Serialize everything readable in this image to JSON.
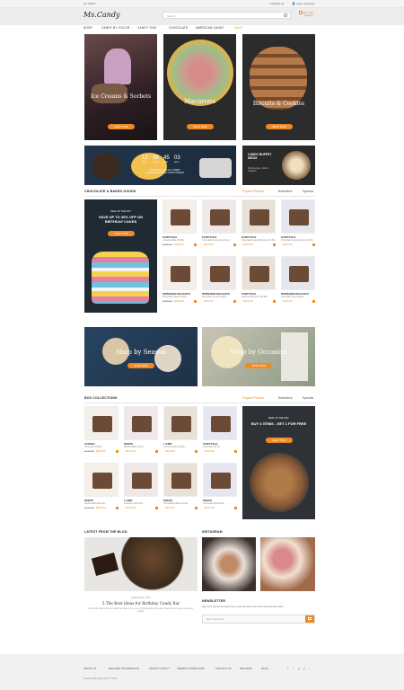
{
  "topbar": {
    "currency": "$ ▾ USD ▾",
    "account": "♡ Wishlist (0)",
    "login": "👤 Login / Register"
  },
  "header": {
    "logo": "Ms.Candy",
    "search_placeholder": "Search",
    "cart_label": "MY CART",
    "cart_items": "0 item(s)"
  },
  "nav": [
    "SHOP",
    "CANDY BY COLOR",
    "CANDY TINS",
    "CHOCOLATE",
    "AMERICAN CANDY",
    "SALE"
  ],
  "banners": {
    "b1_title": "Ice Creams & Sorbets",
    "b1_btn": "SHOP NOW",
    "b2_title": "Macarons",
    "b2_btn": "SHOP NOW",
    "b3_title": "Biscuits & Cookies",
    "b3_btn": "SHOP NOW"
  },
  "promo": {
    "timer": [
      "12",
      "38",
      "45",
      "03"
    ],
    "timer_labels": [
      "DAYS",
      "HOURS",
      "MINS",
      "SECS"
    ],
    "offer_line1": "SAVE UP TO 30% ALL YUMMY",
    "offer_line2": "CANDY. DON'T MISS YOUR CHANCE!",
    "ideas_title": "CANDY BUFFET IDEAS",
    "ideas_sub": "Shop by type, color & occasion"
  },
  "section1": {
    "title": "CHOCOLATE & BAKED GOODS",
    "tabs": [
      "Popular Products",
      "Bestsellers",
      "Specials"
    ],
    "deal_tag": "DEAL OF THE DAY",
    "deal_text": "SAVE UP TO 30% OFF ON BIRTHDAY CAKES",
    "deal_btn": "SHOP NOW",
    "products": [
      {
        "brand": "FAIRYTALE",
        "desc": "Chocolate Bar Gift Box",
        "old": "$135.00",
        "price": "$122.00"
      },
      {
        "brand": "FAIRYTALE",
        "desc": "Chocolate Candy Assortment",
        "old": "",
        "price": "$122.00"
      },
      {
        "brand": "FAIRYTALE",
        "desc": "Chocolate Fudge Brownies Gift Box",
        "old": "",
        "price": "$122.00"
      },
      {
        "brand": "FAIRYTALE",
        "desc": "Chocolate Candy Assortment Box",
        "old": "",
        "price": "$122.00"
      },
      {
        "brand": "WOMHEIN DELIGHTS",
        "desc": "Chocolate Wafer Cookies",
        "old": "$135.00",
        "price": "$122.00"
      },
      {
        "brand": "WOMHEIN DELIGHTS",
        "desc": "Chocolate Chunk Cookies",
        "old": "",
        "price": "$122.00"
      },
      {
        "brand": "FAIRYTALE",
        "desc": "Gourmet Brownies Gift Box",
        "old": "",
        "price": "$122.00"
      },
      {
        "brand": "WOMHEIN DELIGHTS",
        "desc": "Chocolate Chip Cookies",
        "old": "",
        "price": "$122.00"
      }
    ]
  },
  "occasion": {
    "left_title": "Shop by Season",
    "left_btn": "SHOP NOW",
    "right_title": "Shop by Occasion",
    "right_btn": "SHOP NOW"
  },
  "section2": {
    "title": "BOX COLLECTIONS",
    "tabs": [
      "Popular Products",
      "Bestsellers",
      "Specials"
    ],
    "deal_tag": "DEAL OF THE DAY",
    "deal_text": "BUY 4 ITEMS - GET 1 FOR FREE",
    "deal_btn": "SHOP NOW",
    "products": [
      {
        "brand": "GODIVA",
        "desc": "Chocolate Gift Box",
        "old": "$135.00",
        "price": "$122.00"
      },
      {
        "brand": "PEEPS",
        "desc": "Marshmallow Chicks",
        "old": "",
        "price": "$122.00"
      },
      {
        "brand": "L'AMIT",
        "desc": "Candy Assortment Box",
        "old": "",
        "price": "$122.00"
      },
      {
        "brand": "FAIRYTALE",
        "desc": "Chocolate Gift Tin",
        "old": "",
        "price": "$122.00"
      },
      {
        "brand": "PEEPS",
        "desc": "Marshmallow Bunnies",
        "old": "$135.00",
        "price": "$122.00"
      },
      {
        "brand": "L'AMIT",
        "desc": "Caramel Candy Box",
        "old": "",
        "price": "$122.00"
      },
      {
        "brand": "PEEPS",
        "desc": "Pink Marshmallow Chicks",
        "old": "",
        "price": "$122.00"
      },
      {
        "brand": "PEEPS",
        "desc": "Chocolate Dipped Box",
        "old": "",
        "price": "$122.00"
      }
    ]
  },
  "blog": {
    "title": "LATEST FROM THE BLOG",
    "date": "AUGUST 21, 2017",
    "post_title": "5 The Best Ideas for Birthday Candy Bar",
    "excerpt": "Ms.Candy shares the best candy bar ideas for your next birthday party, with sweet treats for every guest and every budget."
  },
  "instagram": {
    "title": "INSTAGRAM"
  },
  "newsletter": {
    "title": "NEWSLETTER",
    "text": "Sign up to receive the latest news, exclusive offers, and other discount information.",
    "placeholder": "Enter Your Email"
  },
  "footer": {
    "links": [
      "ABOUT US",
      "DELIVERY INFORMATION",
      "PRIVACY POLICY",
      "TERMS & CONDITIONS",
      "CONTACT US",
      "RETURNS",
      "BLOG"
    ],
    "copyright": "Powered By OpenCart © 2017"
  },
  "colors": {
    "accent": "#f08a24",
    "dark": "#2b2b2b"
  }
}
